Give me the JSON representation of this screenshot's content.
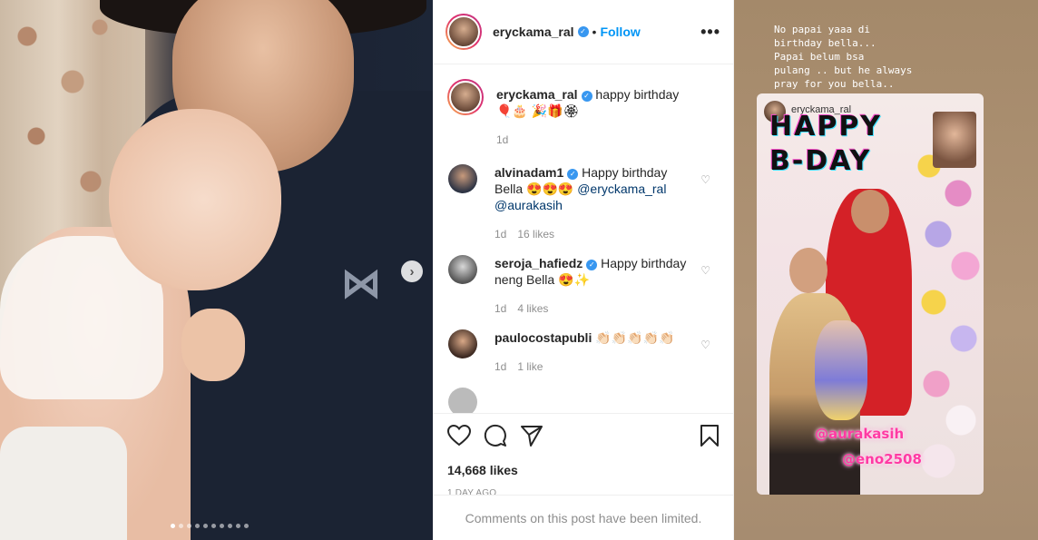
{
  "post": {
    "username": "eryckama_ral",
    "follow_label": "Follow",
    "separator": "•",
    "more_label": "•••",
    "caption": "happy birthday 🎈🎂 🎉🎁🏵",
    "caption_time": "1d",
    "likes": "14,668 likes",
    "time_ago": "1 DAY AGO",
    "limited_text": "Comments on this post have been limited.",
    "next_label": "›",
    "carousel_count": 10
  },
  "comments": [
    {
      "username": "alvinadam1",
      "verified": true,
      "text": "Happy birthday Bella 😍😍😍",
      "mention1": "@eryckama_ral",
      "mention2": "@aurakasih",
      "time": "1d",
      "likes": "16 likes"
    },
    {
      "username": "seroja_hafiedz",
      "verified": true,
      "text": "Happy birthday neng Bella 😍✨",
      "time": "1d",
      "likes": "4 likes"
    },
    {
      "username": "paulocostapubli",
      "verified": false,
      "text": "👏🏻👏🏻👏🏻👏🏻👏🏻",
      "time": "1d",
      "likes": "1 like"
    }
  ],
  "story": {
    "caption": "No papai yaaa di\nbirthday bella...\nPapai belum bsa\npulang .. but he always\npray for you bella..",
    "inner_username": "eryckama_ral",
    "bday_line1": "HAPPY",
    "bday_line2": "B-DAY",
    "tag1": "@aurakasih",
    "tag2": "@eno2508"
  },
  "icons": {
    "heart": "heart-icon",
    "comment": "comment-icon",
    "share": "share-icon",
    "save": "bookmark-icon",
    "verified": "verified-badge-icon"
  },
  "colors": {
    "link": "#0095f6",
    "verified": "#3897f0",
    "muted": "#8e8e8e"
  }
}
